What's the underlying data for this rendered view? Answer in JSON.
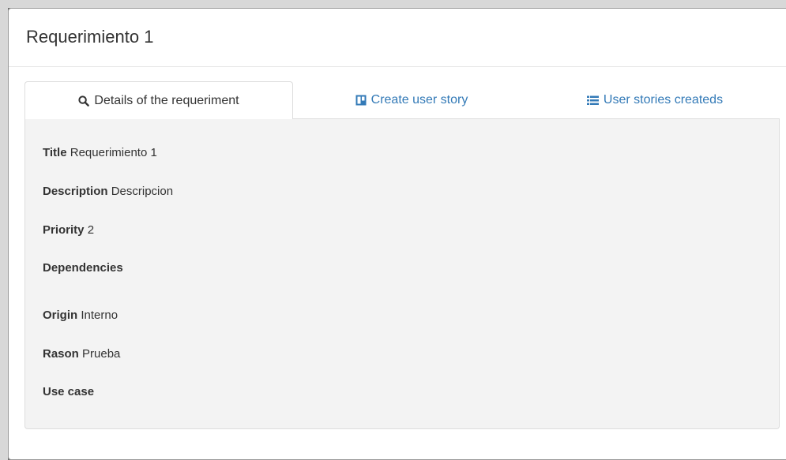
{
  "modal": {
    "title": "Requerimiento 1"
  },
  "tabs": [
    {
      "label": "Details of the requeriment",
      "icon": "search-icon",
      "active": true
    },
    {
      "label": "Create user story",
      "icon": "board-icon",
      "active": false
    },
    {
      "label": "User stories createds",
      "icon": "list-icon",
      "active": false
    }
  ],
  "details": {
    "title": {
      "label": "Title",
      "value": "Requerimiento 1"
    },
    "description": {
      "label": "Description",
      "value": "Descripcion"
    },
    "priority": {
      "label": "Priority",
      "value": "2"
    },
    "dependencies": {
      "label": "Dependencies",
      "value": ""
    },
    "origin": {
      "label": "Origin",
      "value": "Interno"
    },
    "rason": {
      "label": "Rason",
      "value": "Prueba"
    },
    "use_case": {
      "label": "Use case",
      "value": ""
    }
  },
  "colors": {
    "link": "#337ab7",
    "panel_bg": "#f3f3f3",
    "text": "#333333"
  }
}
